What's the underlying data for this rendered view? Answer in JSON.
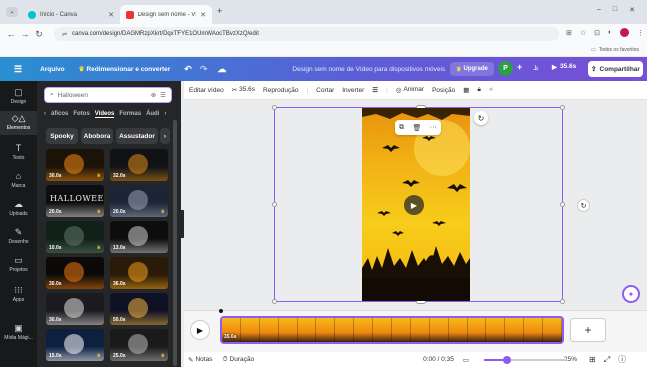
{
  "browser": {
    "tabs": [
      {
        "label": "Início - Canva",
        "active": false
      },
      {
        "label": "Design sem nome - Vídeo para",
        "active": true
      }
    ],
    "new_tab": "+",
    "window_controls": [
      "–",
      "□",
      "✕"
    ],
    "url": "canva.com/design/DAGMRzpXkrt/DqxTFYE1OUmWAocTBvzXzQ/edit",
    "bookmarks_label": "Todos os favoritos"
  },
  "header": {
    "menu_icon": "☰",
    "file_label": "Arquivo",
    "resize_label": "Redimensionar e converter",
    "design_title": "Design sem nome de Vídeo para dispositivos móveis",
    "upgrade_label": "Upgrade",
    "avatar_letter": "P",
    "plus": "+",
    "duration": "35.6s",
    "share_label": "Compartilhar"
  },
  "rail": [
    {
      "label": "Design",
      "icon": "▢",
      "name": "design"
    },
    {
      "label": "Elementos",
      "icon": "◇△",
      "name": "elements",
      "selected": true
    },
    {
      "label": "Texto",
      "icon": "T",
      "name": "text"
    },
    {
      "label": "Marca",
      "icon": "⌂",
      "name": "brand"
    },
    {
      "label": "Uploads",
      "icon": "☁",
      "name": "uploads"
    },
    {
      "label": "Desenho",
      "icon": "✎",
      "name": "draw"
    },
    {
      "label": "Projetos",
      "icon": "▭",
      "name": "projects"
    },
    {
      "label": "Apps",
      "icon": "⁝⁝⁝",
      "name": "apps"
    },
    {
      "label": "Mídia Mági...",
      "icon": "▣",
      "name": "magic-media"
    }
  ],
  "panel": {
    "search_value": "Halloween",
    "content_tabs": [
      "‹",
      "áficos",
      "Fotos",
      "Vídeos",
      "Formas",
      "Áudi",
      "›"
    ],
    "active_tab": "Vídeos",
    "chips": [
      "Spooky",
      "Abobora",
      "Assustador",
      "›"
    ],
    "thumbs": [
      {
        "duration": "30.0s",
        "premium": true,
        "bg": "#1b1208",
        "accent": "#f08a10"
      },
      {
        "duration": "32.0s",
        "premium": false,
        "bg": "#101216",
        "accent": "#d98a1a"
      },
      {
        "duration": "20.0s",
        "premium": true,
        "bg": "#0e0e10",
        "accent": "#e9e9e9",
        "text": "HALLOWEEN"
      },
      {
        "duration": "20.0s",
        "premium": true,
        "bg": "#1c2535",
        "accent": "#9aa3b4"
      },
      {
        "duration": "10.0s",
        "premium": true,
        "bg": "#12201a",
        "accent": "#5d7a66"
      },
      {
        "duration": "13.0s",
        "premium": false,
        "bg": "#0d0d0d",
        "accent": "#cfcfcf"
      },
      {
        "duration": "30.0s",
        "premium": false,
        "bg": "#0c0a08",
        "accent": "#f07a10"
      },
      {
        "duration": "36.0s",
        "premium": false,
        "bg": "#2a1a08",
        "accent": "#f4a21a"
      },
      {
        "duration": "30.0s",
        "premium": false,
        "bg": "#1b1b1f",
        "accent": "#e0e0e0"
      },
      {
        "duration": "50.0s",
        "premium": false,
        "bg": "#0e1224",
        "accent": "#f2b440"
      },
      {
        "duration": "15.0s",
        "premium": true,
        "bg": "#0d2040",
        "accent": "#ffffff"
      },
      {
        "duration": "25.0s",
        "premium": true,
        "bg": "#1a1a1a",
        "accent": "#bbbbbb"
      }
    ]
  },
  "toolbar": {
    "edit_video": "Editar vídeo",
    "trim_duration": "35.6s",
    "playback": "Reprodução",
    "cut": "Cortar",
    "flip": "Inverter",
    "animate": "Animar",
    "position": "Posição"
  },
  "context_menu": [
    "⧉",
    "🗑",
    "···"
  ],
  "timeline": {
    "clip_duration": "35.6s",
    "add": "+"
  },
  "bottom": {
    "notes": "Notas",
    "duration": "Duração",
    "time": "0:00 / 0:35",
    "zoom": "25%",
    "zoom_fraction": 0.25
  },
  "colors": {
    "accent": "#8b5cf6",
    "header_start": "#2a8fd0",
    "header_end": "#7a4fd8",
    "premium_crown": "#fdd835"
  }
}
